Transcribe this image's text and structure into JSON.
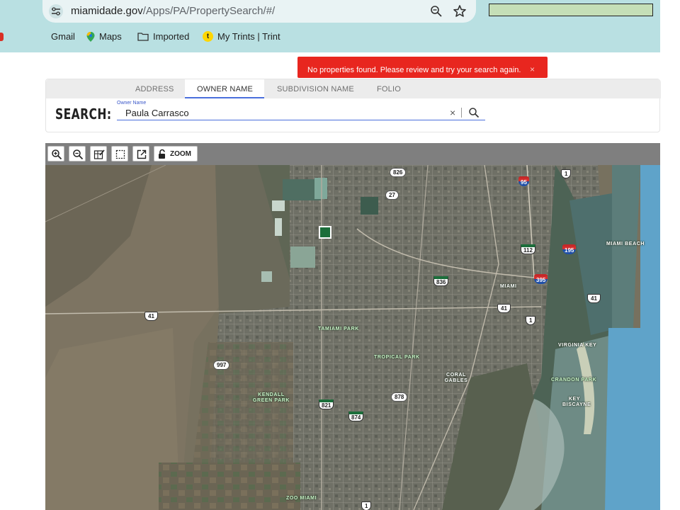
{
  "browser": {
    "url_domain": "miamidade.gov",
    "url_path": "/Apps/PA/PropertySearch/#/",
    "bookmarks": [
      {
        "label": "Gmail",
        "icon": "gmail-icon"
      },
      {
        "label": "Maps",
        "icon": "maps-pin-icon"
      },
      {
        "label": "Imported",
        "icon": "folder-icon"
      },
      {
        "label": "My Trints | Trint",
        "icon": "trint-icon"
      }
    ]
  },
  "toast": {
    "message": "No properties found. Please review and try your search again.",
    "close": "×",
    "color": "#e8261f"
  },
  "search": {
    "tabs": [
      "ADDRESS",
      "OWNER NAME",
      "SUBDIVISION NAME",
      "FOLIO"
    ],
    "active_tab": "OWNER NAME",
    "label": "SEARCH:",
    "field_caption": "Owner Name",
    "value": "Paula Carrasco",
    "clear": "×",
    "accent": "#4a6fdc"
  },
  "map_toolbar": {
    "zoom_label": "ZOOM",
    "tools": [
      "zoom-in-icon",
      "zoom-out-icon",
      "edit-layer-icon",
      "select-box-icon",
      "open-external-icon",
      "unlock-icon"
    ]
  },
  "map": {
    "roads": [
      "826",
      "27",
      "1",
      "95",
      "112",
      "836",
      "41",
      "395",
      "997",
      "874",
      "878",
      "821"
    ],
    "places": [
      "MIAMI BEACH",
      "MIAMI",
      "TAMIAMI PARK",
      "TROPICAL PARK",
      "CORAL GABLES",
      "VIRGINIA KEY",
      "CRANDON PARK",
      "KEY BISCAYNE",
      "KENDALL GREEN PARK",
      "ZOO MIAMI"
    ]
  }
}
